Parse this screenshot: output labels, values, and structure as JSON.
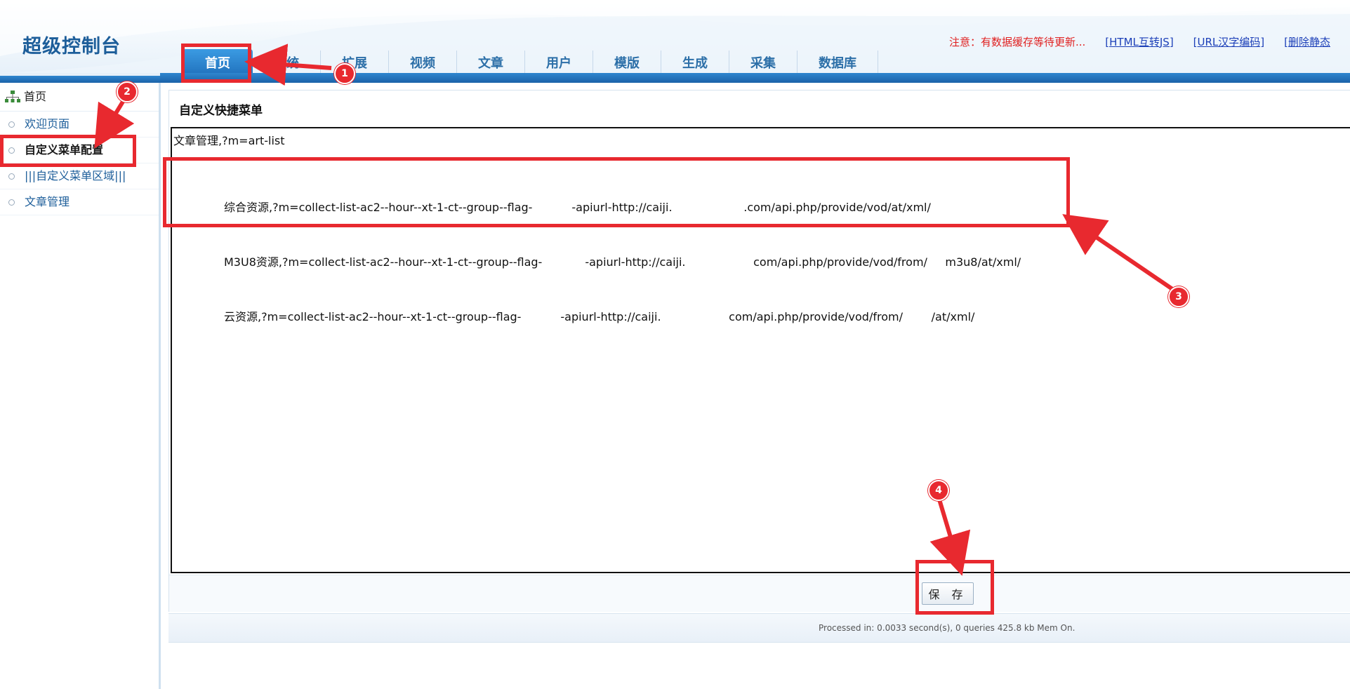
{
  "header": {
    "brand": "超级控制台",
    "notice": "注意：有数据缓存等待更新...",
    "links": [
      "[HTML互转JS]",
      "[URL汉字编码]",
      "[删除静态"
    ]
  },
  "nav": {
    "items": [
      "首页",
      "系统",
      "扩展",
      "视频",
      "文章",
      "用户",
      "模版",
      "生成",
      "采集",
      "数据库"
    ],
    "active_index": 0
  },
  "sidebar": {
    "title": "首页",
    "items": [
      "欢迎页面",
      "自定义菜单配置",
      "|||自定义菜单区域|||",
      "文章管理"
    ],
    "active_index": 1
  },
  "main": {
    "title": "自定义快捷菜单",
    "editor_line1": "文章管理,?m=art-list",
    "editor_lines": [
      "综合资源,?m=collect-list-ac2--hour--xt-1-ct--group--flag-           -apiurl-http://caiji.                    .com/api.php/provide/vod/at/xml/",
      "M3U8资源,?m=collect-list-ac2--hour--xt-1-ct--group--flag-            -apiurl-http://caiji.                   com/api.php/provide/vod/from/     m3u8/at/xml/",
      "云资源,?m=collect-list-ac2--hour--xt-1-ct--group--flag-           -apiurl-http://caiji.                   com/api.php/provide/vod/from/        /at/xml/"
    ],
    "save_label": "保 存"
  },
  "footer": {
    "text": "Processed in: 0.0033 second(s), 0 queries 425.8 kb Mem On."
  },
  "annotations": {
    "badges": [
      "1",
      "2",
      "3",
      "4"
    ],
    "color": "#e8292f"
  }
}
